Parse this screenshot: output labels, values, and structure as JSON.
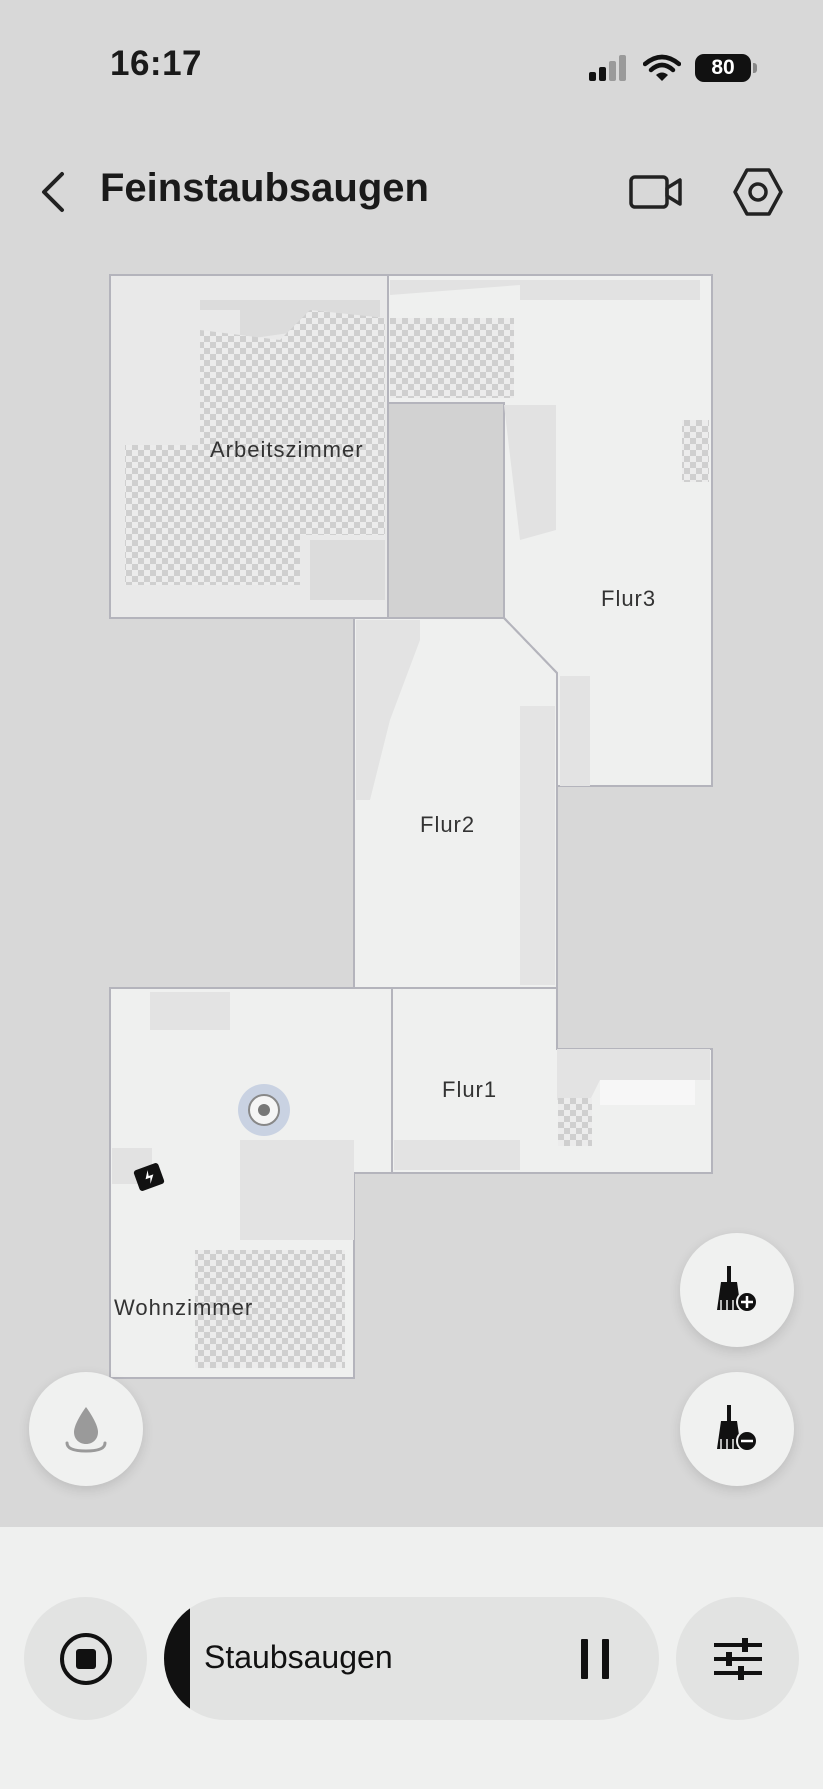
{
  "status_bar": {
    "time": "16:17",
    "battery": "80"
  },
  "header": {
    "title": "Feinstaubsaugen"
  },
  "map": {
    "rooms": [
      {
        "id": "arbeitszimmer",
        "label": "Arbeitszimmer"
      },
      {
        "id": "flur3",
        "label": "Flur3"
      },
      {
        "id": "flur2",
        "label": "Flur2"
      },
      {
        "id": "flur1",
        "label": "Flur1"
      },
      {
        "id": "wohnzimmer",
        "label": "Wohnzimmer"
      }
    ]
  },
  "controls": {
    "mode_label": "Staubsaugen"
  },
  "icons": {
    "back": "chevron-left-icon",
    "video": "video-camera-icon",
    "settings": "hexagon-gear-icon",
    "water": "water-drop-icon",
    "add_clean": "broom-plus-icon",
    "remove_clean": "broom-minus-icon",
    "stop": "stop-icon",
    "pause": "pause-icon",
    "adjust": "sliders-icon"
  }
}
